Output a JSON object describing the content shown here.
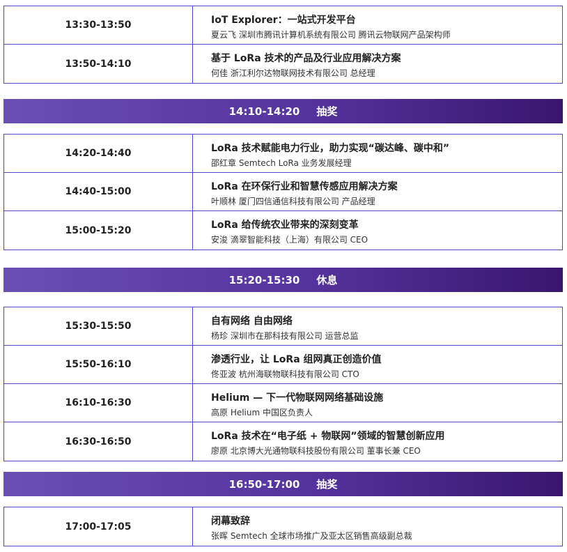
{
  "block1": [
    {
      "time": "13:30-13:50",
      "title": "IoT Explorer：一站式开发平台",
      "speaker": "夏云飞 深圳市腾讯计算机系统有限公司 腾讯云物联网产品架构师"
    },
    {
      "time": "13:50-14:10",
      "title": "基于 LoRa 技术的产品及行业应用解决方案",
      "speaker": "何佳 浙江利尔达物联网技术有限公司 总经理"
    }
  ],
  "break1": {
    "time": "14:10-14:20",
    "label": "抽奖"
  },
  "block2": [
    {
      "time": "14:20-14:40",
      "title": "LoRa 技术赋能电力行业，助力实现“碳达峰、碳中和”",
      "speaker": "邵红章 Semtech LoRa 业务发展经理"
    },
    {
      "time": "14:40-15:00",
      "title": "LoRa 在环保行业和智慧传感应用解决方案",
      "speaker": "叶顺林 厦门四信通信科技有限公司 产品经理"
    },
    {
      "time": "15:00-15:20",
      "title": "LoRa 给传统农业带来的深刻变革",
      "speaker": "安浚 滴翠智能科技（上海）有限公司 CEO"
    }
  ],
  "break2": {
    "time": "15:20-15:30",
    "label": "休息"
  },
  "block3": [
    {
      "time": "15:30-15:50",
      "title": "自有网络 自由网络",
      "speaker": "杨珍 深圳市在那科技有限公司 运营总监"
    },
    {
      "time": "15:50-16:10",
      "title": "渗透行业，让 LoRa 组网真正创造价值",
      "speaker": "佟亚波 杭州海联物联科技有限公司 CTO"
    },
    {
      "time": "16:10-16:30",
      "title": "Helium — 下一代物联网网络基础设施",
      "speaker": "高原 Helium 中国区负责人"
    },
    {
      "time": "16:30-16:50",
      "title": "LoRa 技术在“电子纸 + 物联网”领域的智慧创新应用",
      "speaker": "廖原 北京博大光通物联科技股份有限公司 董事长兼 CEO"
    }
  ],
  "break3": {
    "time": "16:50-17:00",
    "label": "抽奖"
  },
  "block4": [
    {
      "time": "17:00-17:05",
      "title": "闭幕致辞",
      "speaker": "张晖 Semtech 全球市场推广及亚太区销售高级副总裁"
    }
  ]
}
